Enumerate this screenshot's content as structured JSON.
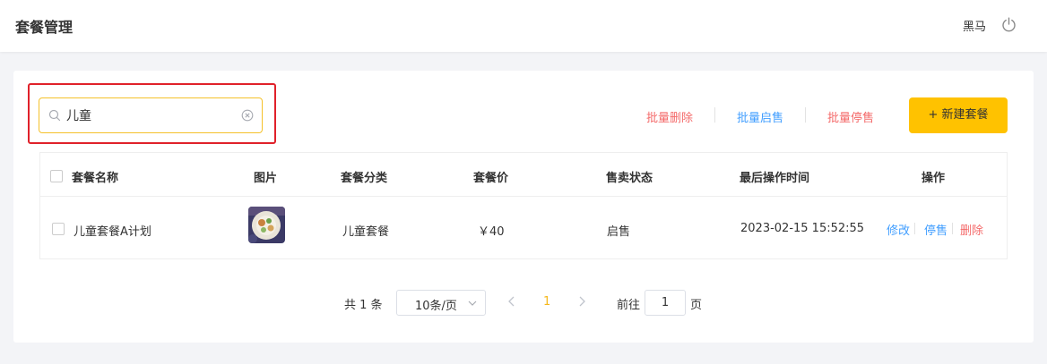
{
  "header": {
    "title": "套餐管理",
    "user": "黑马",
    "power_icon": "power-icon"
  },
  "toolbar": {
    "search_value": "儿童",
    "search_placeholder": "",
    "batch_delete": "批量删除",
    "batch_start": "批量启售",
    "batch_stop": "批量停售",
    "new_button": "+ 新建套餐",
    "accent_color": "#ffc200",
    "danger_color": "#f46a6a",
    "link_color": "#419eff",
    "highlight_color": "#e0212a"
  },
  "table": {
    "columns": [
      "套餐名称",
      "图片",
      "套餐分类",
      "套餐价",
      "售卖状态",
      "最后操作时间",
      "操作"
    ],
    "rows": [
      {
        "name": "儿童套餐A计划",
        "category": "儿童套餐",
        "price": "￥40",
        "status": "启售",
        "updated": "2023-02-15 15:52:55",
        "actions": [
          "修改",
          "停售",
          "删除"
        ]
      }
    ]
  },
  "pagination": {
    "total": "共 1 条",
    "page_size": "10条/页",
    "current": "1",
    "goto_prefix": "前往",
    "goto_value": "1",
    "goto_suffix": "页"
  }
}
